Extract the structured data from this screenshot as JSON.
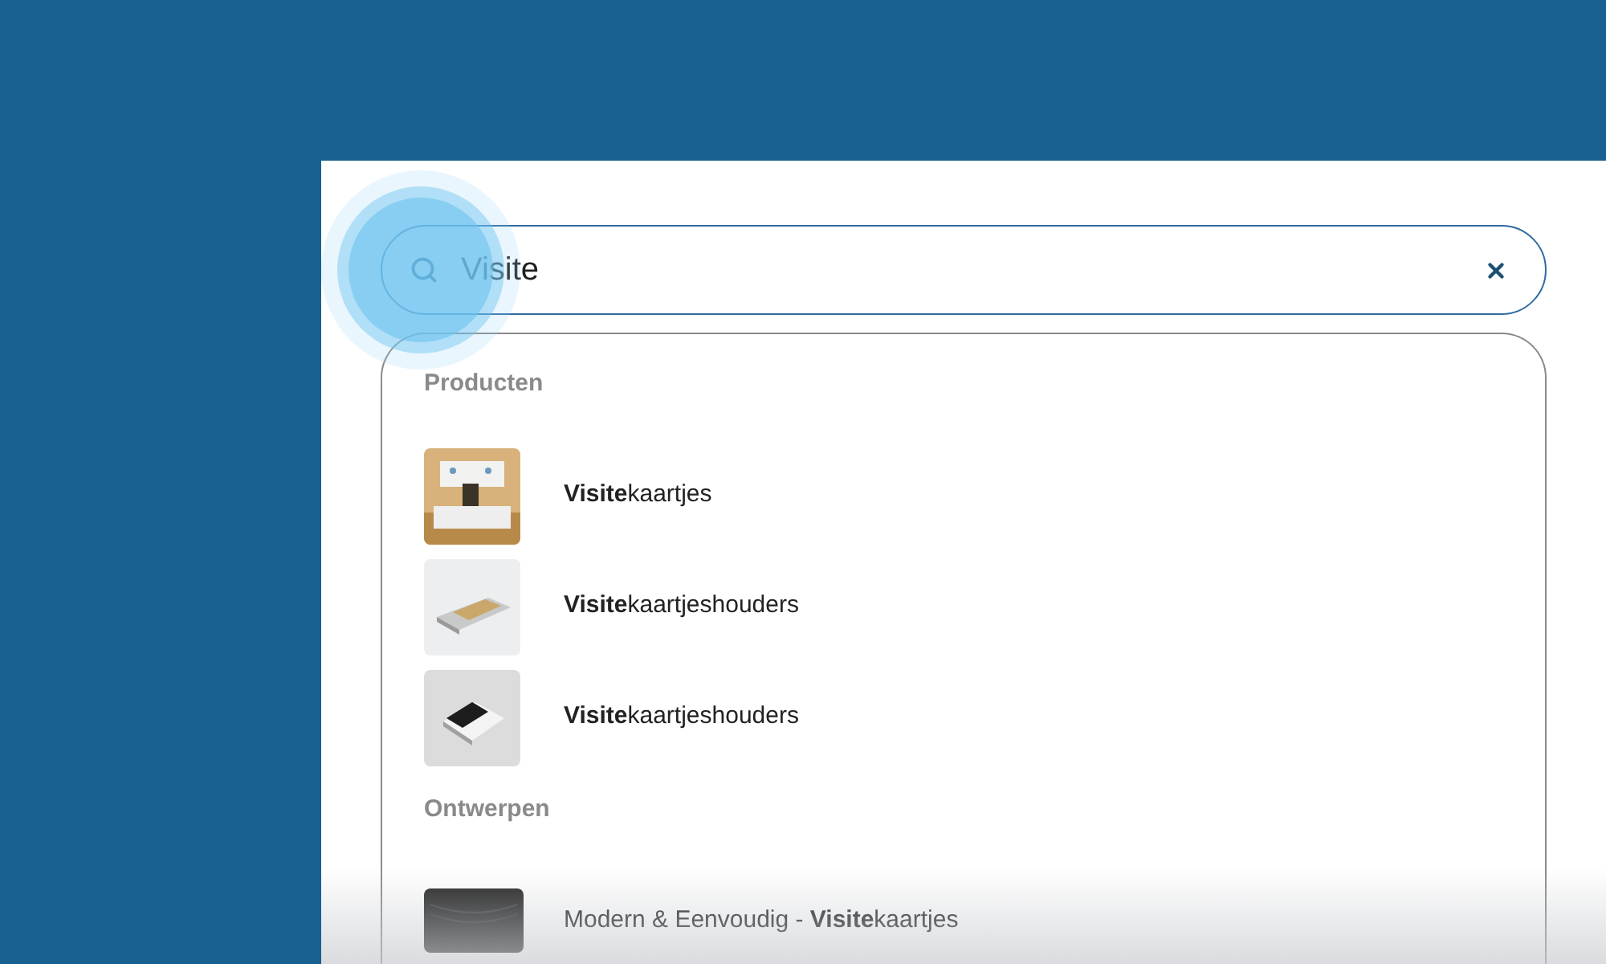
{
  "search": {
    "value": "Visite"
  },
  "sections": [
    {
      "title": "Producten",
      "items": [
        {
          "label": "**Visite**kaartjes"
        },
        {
          "label": "**Visite**kaartjeshouders"
        },
        {
          "label": "**Visite**kaartjeshouders"
        }
      ]
    },
    {
      "title": "Ontwerpen",
      "items": [
        {
          "label": "Modern & Eenvoudig - **Visite**kaartjes"
        }
      ]
    }
  ]
}
